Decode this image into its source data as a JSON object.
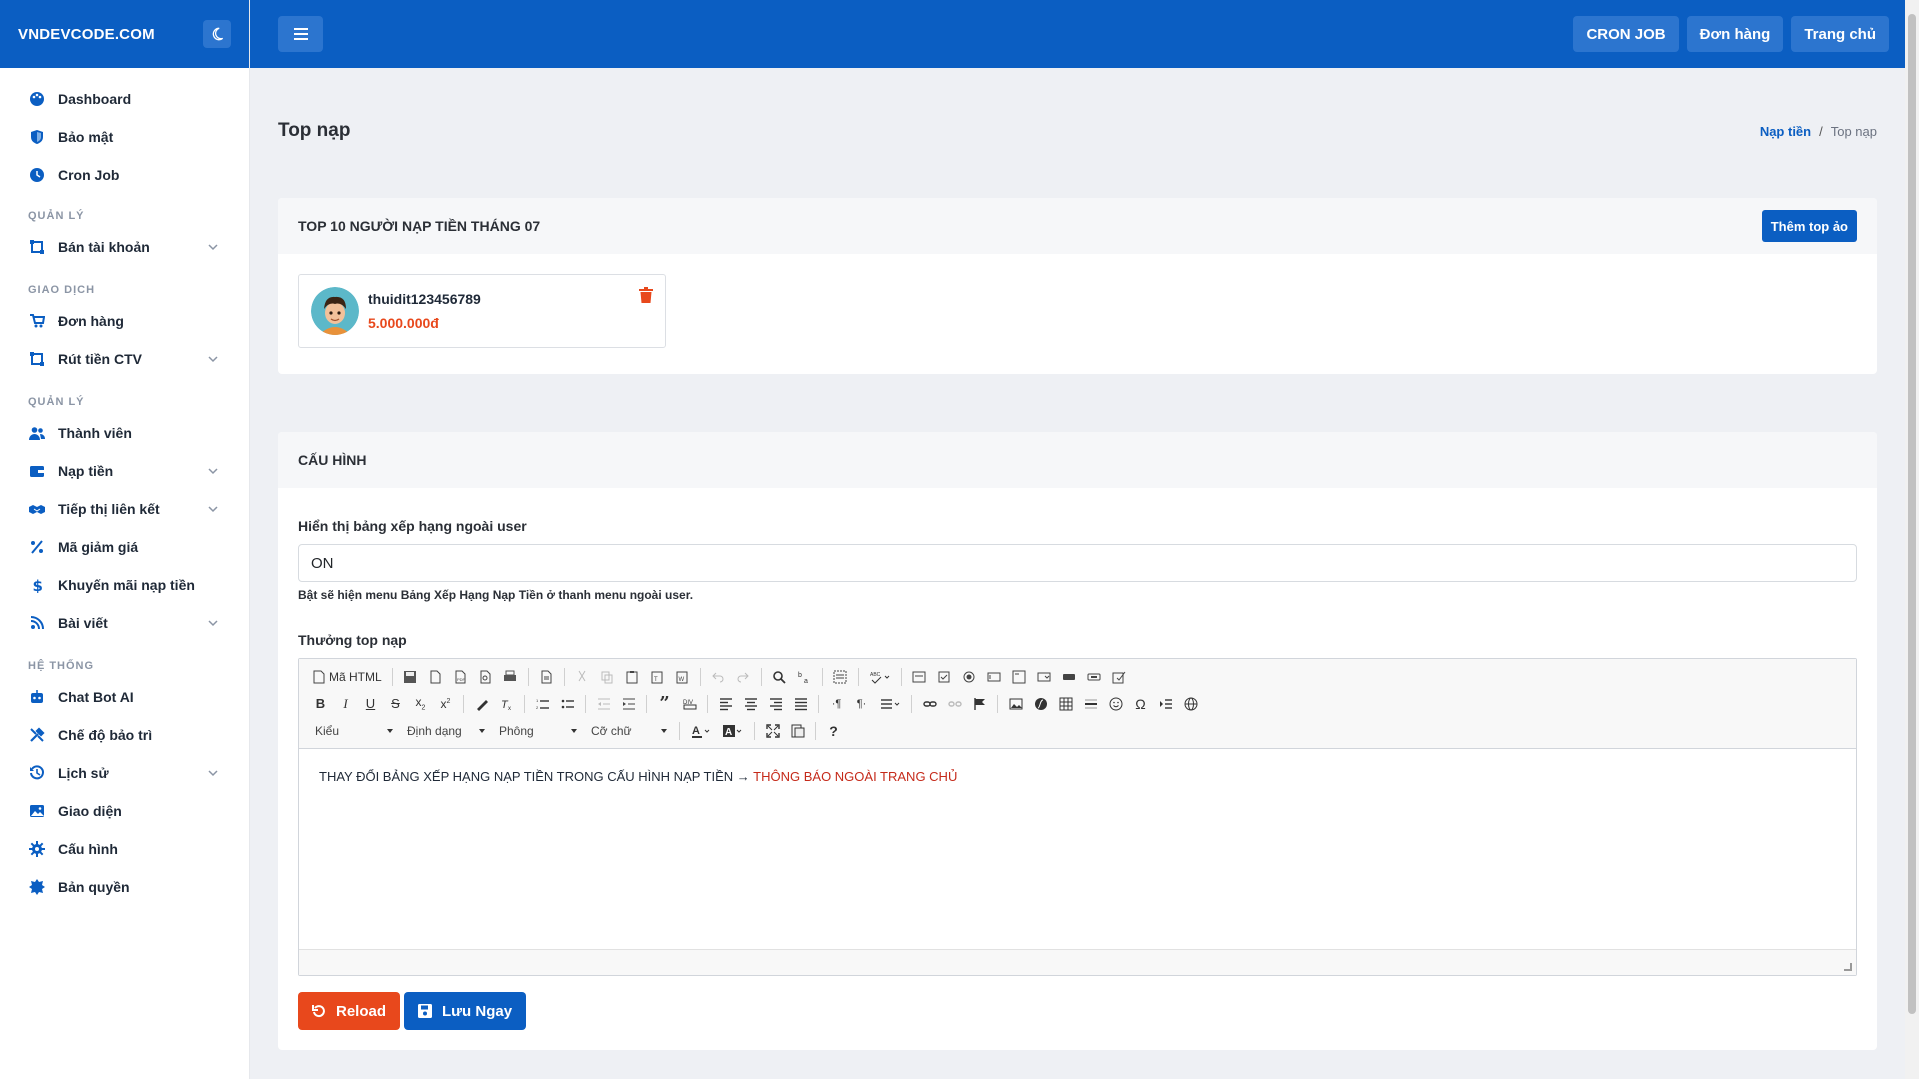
{
  "brand": {
    "name": "VNDEVCODE.COM"
  },
  "sidebar": {
    "groups": [
      {
        "section": "",
        "items": [
          {
            "label": "Dashboard",
            "icon": "palette-icon",
            "chevron": false
          },
          {
            "label": "Bảo mật",
            "icon": "shield-icon",
            "chevron": false
          },
          {
            "label": "Cron Job",
            "icon": "clock-icon",
            "chevron": false
          }
        ]
      },
      {
        "section": "QUẢN LÝ",
        "items": [
          {
            "label": "Bán tài khoản",
            "icon": "box-icon",
            "chevron": true
          }
        ]
      },
      {
        "section": "GIAO DỊCH",
        "items": [
          {
            "label": "Đơn hàng",
            "icon": "cart-icon",
            "chevron": false
          },
          {
            "label": "Rút tiền CTV",
            "icon": "box-icon",
            "chevron": true
          }
        ]
      },
      {
        "section": "QUẢN LÝ",
        "items": [
          {
            "label": "Thành viên",
            "icon": "users-icon",
            "chevron": false
          },
          {
            "label": "Nạp tiền",
            "icon": "wallet-icon",
            "chevron": true
          },
          {
            "label": "Tiếp thị liên kết",
            "icon": "handshake-icon",
            "chevron": true
          },
          {
            "label": "Mã giảm giá",
            "icon": "percent-icon",
            "chevron": false
          },
          {
            "label": "Khuyến mãi nạp tiền",
            "icon": "dollar-icon",
            "chevron": false
          },
          {
            "label": "Bài viết",
            "icon": "blog-icon",
            "chevron": true
          }
        ]
      },
      {
        "section": "HỆ THỐNG",
        "items": [
          {
            "label": "Chat Bot AI",
            "icon": "robot-icon",
            "chevron": false
          },
          {
            "label": "Chế độ bảo trì",
            "icon": "tools-icon",
            "chevron": false
          },
          {
            "label": "Lịch sử",
            "icon": "history-icon",
            "chevron": true
          },
          {
            "label": "Giao diện",
            "icon": "image-icon",
            "chevron": false
          },
          {
            "label": "Cấu hình",
            "icon": "gear-icon",
            "chevron": false
          },
          {
            "label": "Bản quyền",
            "icon": "badge-icon",
            "chevron": false
          }
        ]
      }
    ]
  },
  "topbar": {
    "buttons": [
      "CRON JOB",
      "Đơn hàng",
      "Trang chủ"
    ]
  },
  "page": {
    "title": "Top nạp",
    "breadcrumb": {
      "parent": "Nạp tiền",
      "current": "Top nạp"
    }
  },
  "top_card": {
    "title": "TOP 10 NGƯỜI NẠP TIỀN THÁNG 07",
    "add_button": "Thêm top ảo",
    "entries": [
      {
        "username": "thuidit123456789",
        "amount": "5.000.000đ"
      }
    ]
  },
  "config": {
    "title": "CẤU HÌNH",
    "display_label": "Hiển thị bảng xếp hạng ngoài user",
    "display_value": "ON",
    "display_hint": "Bật sẽ hiện menu Bảng Xếp Hạng Nạp Tiền ở thanh menu ngoài user.",
    "reward_label": "Thưởng top nạp",
    "editor": {
      "source_label": "Mã HTML",
      "combos": [
        "Kiểu",
        "Định dạng",
        "Phông",
        "Cỡ chữ"
      ],
      "content_main": "THAY ĐỔI BẢNG XẾP HẠNG NẠP TIỀN TRONG CẤU HÌNH NẠP TIỀN →",
      "content_highlight": "THÔNG BÁO NGOÀI TRANG CHỦ"
    },
    "reload_button": "Reload",
    "save_button": "Lưu Ngay"
  },
  "colors": {
    "primary": "#0b5ec2",
    "danger": "#e8481c",
    "background": "#eef0f4"
  }
}
